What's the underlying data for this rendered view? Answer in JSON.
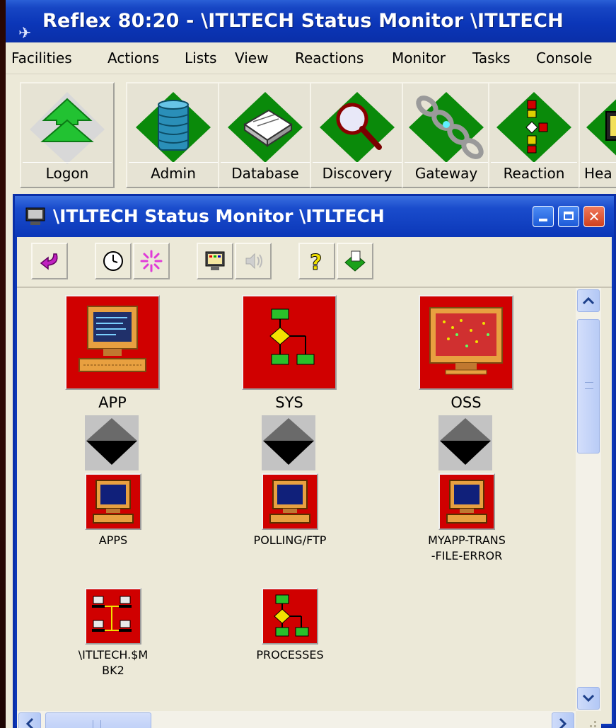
{
  "window": {
    "title": "Reflex 80:20 - \\ITLTECH Status Monitor \\ITLTECH"
  },
  "menu": [
    "Facilities",
    "Actions",
    "Lists",
    "View",
    "Reactions",
    "Monitor",
    "Tasks",
    "Console"
  ],
  "toolbar": {
    "buttons": [
      {
        "label": "Logon",
        "icon": "logon-icon"
      },
      {
        "label": "Admin",
        "icon": "database-stack-icon"
      },
      {
        "label": "Database",
        "icon": "book-icon"
      },
      {
        "label": "Discovery",
        "icon": "magnifier-icon"
      },
      {
        "label": "Gateway",
        "icon": "chain-icon"
      },
      {
        "label": "Reaction",
        "icon": "flowchart-icon"
      },
      {
        "label": "Hea",
        "icon": "monitor-icon"
      }
    ]
  },
  "monitor": {
    "title": "\\ITLTECH Status Monitor \\ITLTECH",
    "toolbar_icons": [
      "back-icon",
      "clock-icon",
      "burst-icon",
      "monitor-icon",
      "speaker-icon",
      "help-icon",
      "export-icon"
    ],
    "colors": {
      "alert": "#d00000",
      "titlebar": "#0b36b8"
    },
    "top_nodes": [
      {
        "label": "APP",
        "icon": "computer-terminal-icon"
      },
      {
        "label": "SYS",
        "icon": "flowchart-icon"
      },
      {
        "label": "OSS",
        "icon": "display-monitor-icon"
      }
    ],
    "child_nodes": [
      {
        "label": "APPS",
        "icon": "computer-icon"
      },
      {
        "label": "POLLING/FTP",
        "icon": "computer-icon"
      },
      {
        "label": "MYAPP-TRANS\n-FILE-ERROR",
        "icon": "computer-icon"
      },
      {
        "label": "\\ITLTECH.$M\nBK2",
        "icon": "network-icon"
      },
      {
        "label": "PROCESSES",
        "icon": "flowchart-icon"
      }
    ]
  }
}
